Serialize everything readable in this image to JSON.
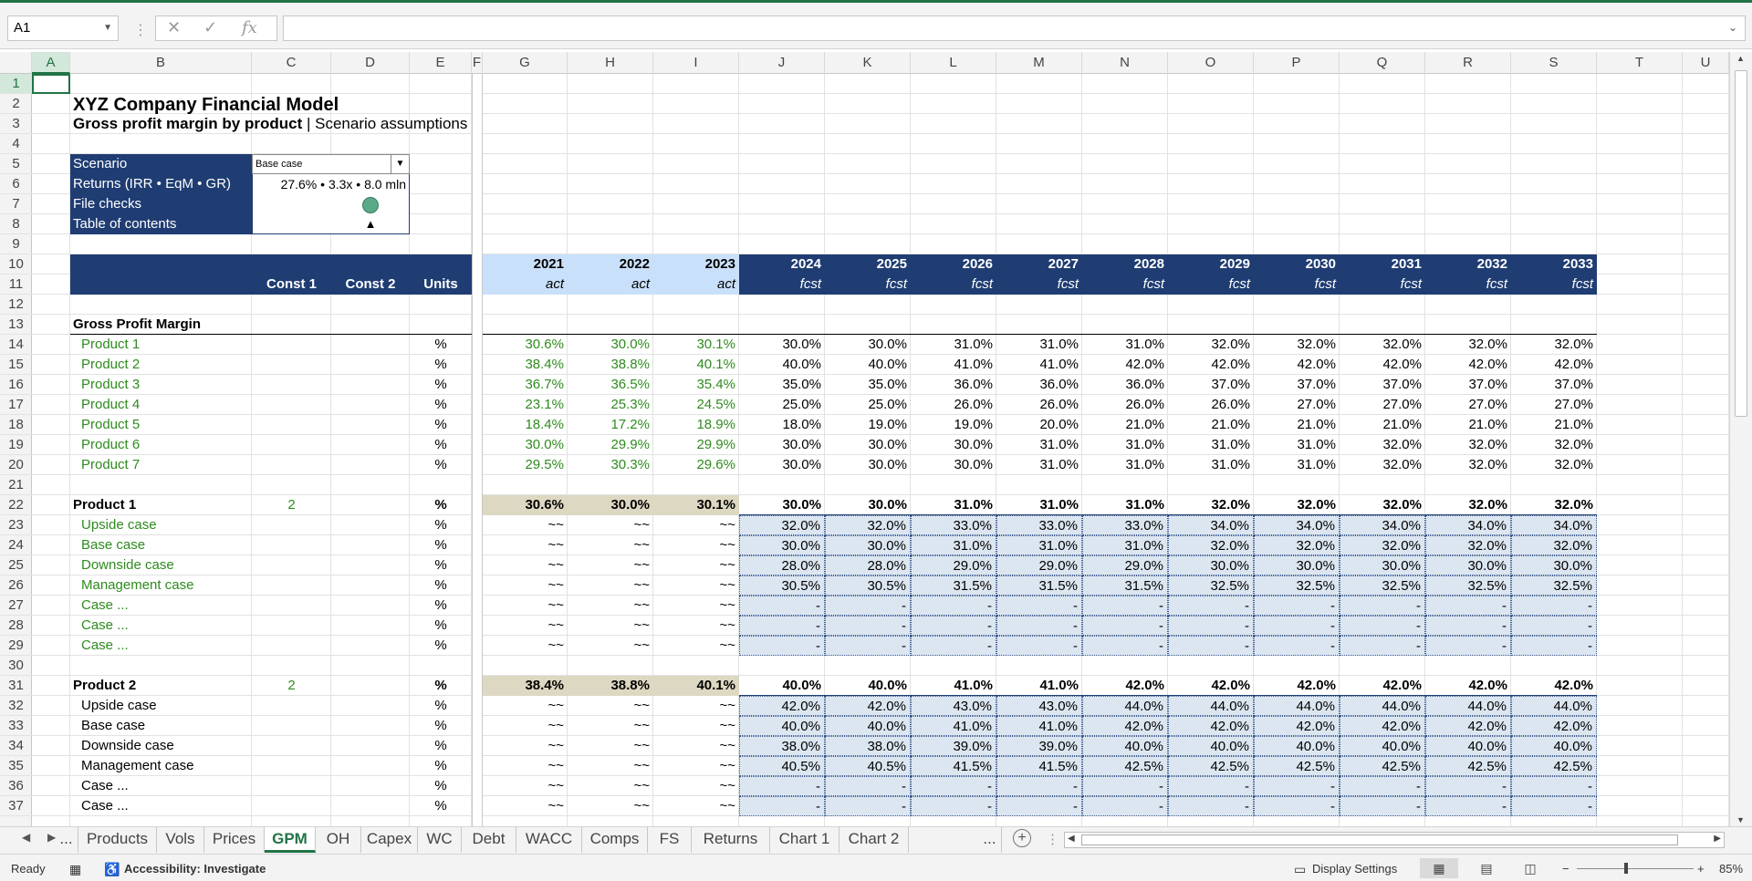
{
  "formula_bar": {
    "name_box": "A1",
    "formula": ""
  },
  "columns": [
    "A",
    "B",
    "C",
    "D",
    "E",
    "F",
    "G",
    "H",
    "I",
    "J",
    "K",
    "L",
    "M",
    "N",
    "O",
    "P",
    "Q",
    "R",
    "S",
    "T",
    "U"
  ],
  "rows": [
    "1",
    "2",
    "3",
    "4",
    "5",
    "6",
    "7",
    "8",
    "9",
    "10",
    "11",
    "12",
    "13",
    "14",
    "15",
    "16",
    "17",
    "18",
    "19",
    "20",
    "21",
    "22",
    "23",
    "24",
    "25",
    "26",
    "27",
    "28",
    "29",
    "30",
    "31",
    "32",
    "33",
    "34",
    "35",
    "36",
    "37"
  ],
  "title": "XYZ Company Financial Model",
  "subtitle_bold": "Gross profit margin by product",
  "subtitle_rest": " | Scenario assumptions",
  "info": {
    "scenario_label": "Scenario",
    "scenario_value": "Base case",
    "returns_label": "Returns (IRR • EqM • GR)",
    "returns_value": "27.6% • 3.3x • 8.0 mln",
    "checks_label": "File checks",
    "toc_label": "Table of contents",
    "toc_glyph": "▲",
    "check_color": "#5aaa8a"
  },
  "header": {
    "const1": "Const 1",
    "const2": "Const 2",
    "units": "Units",
    "years": [
      "2021",
      "2022",
      "2023",
      "2024",
      "2025",
      "2026",
      "2027",
      "2028",
      "2029",
      "2030",
      "2031",
      "2032",
      "2033"
    ],
    "kinds": [
      "act",
      "act",
      "act",
      "fcst",
      "fcst",
      "fcst",
      "fcst",
      "fcst",
      "fcst",
      "fcst",
      "fcst",
      "fcst",
      "fcst"
    ]
  },
  "gpm": {
    "label": "Gross Profit Margin",
    "rows": [
      {
        "name": "Product 1",
        "unit": "%",
        "v": [
          "30.6%",
          "30.0%",
          "30.1%",
          "30.0%",
          "30.0%",
          "31.0%",
          "31.0%",
          "31.0%",
          "32.0%",
          "32.0%",
          "32.0%",
          "32.0%",
          "32.0%"
        ]
      },
      {
        "name": "Product 2",
        "unit": "%",
        "v": [
          "38.4%",
          "38.8%",
          "40.1%",
          "40.0%",
          "40.0%",
          "41.0%",
          "41.0%",
          "42.0%",
          "42.0%",
          "42.0%",
          "42.0%",
          "42.0%",
          "42.0%"
        ]
      },
      {
        "name": "Product 3",
        "unit": "%",
        "v": [
          "36.7%",
          "36.5%",
          "35.4%",
          "35.0%",
          "35.0%",
          "36.0%",
          "36.0%",
          "36.0%",
          "37.0%",
          "37.0%",
          "37.0%",
          "37.0%",
          "37.0%"
        ]
      },
      {
        "name": "Product 4",
        "unit": "%",
        "v": [
          "23.1%",
          "25.3%",
          "24.5%",
          "25.0%",
          "25.0%",
          "26.0%",
          "26.0%",
          "26.0%",
          "26.0%",
          "27.0%",
          "27.0%",
          "27.0%",
          "27.0%"
        ]
      },
      {
        "name": "Product 5",
        "unit": "%",
        "v": [
          "18.4%",
          "17.2%",
          "18.9%",
          "18.0%",
          "19.0%",
          "19.0%",
          "20.0%",
          "21.0%",
          "21.0%",
          "21.0%",
          "21.0%",
          "21.0%",
          "21.0%"
        ]
      },
      {
        "name": "Product 6",
        "unit": "%",
        "v": [
          "30.0%",
          "29.9%",
          "29.9%",
          "30.0%",
          "30.0%",
          "30.0%",
          "31.0%",
          "31.0%",
          "31.0%",
          "31.0%",
          "32.0%",
          "32.0%",
          "32.0%"
        ]
      },
      {
        "name": "Product 7",
        "unit": "%",
        "v": [
          "29.5%",
          "30.3%",
          "29.6%",
          "30.0%",
          "30.0%",
          "30.0%",
          "31.0%",
          "31.0%",
          "31.0%",
          "31.0%",
          "32.0%",
          "32.0%",
          "32.0%"
        ]
      }
    ]
  },
  "blocks": [
    {
      "name": "Product 1",
      "const1": "2",
      "unit": "%",
      "green": true,
      "v": [
        "30.6%",
        "30.0%",
        "30.1%",
        "30.0%",
        "30.0%",
        "31.0%",
        "31.0%",
        "31.0%",
        "32.0%",
        "32.0%",
        "32.0%",
        "32.0%",
        "32.0%"
      ],
      "cases": [
        {
          "name": "Upside case",
          "unit": "%",
          "v": [
            "32.0%",
            "32.0%",
            "33.0%",
            "33.0%",
            "33.0%",
            "34.0%",
            "34.0%",
            "34.0%",
            "34.0%",
            "34.0%"
          ]
        },
        {
          "name": "Base case",
          "unit": "%",
          "v": [
            "30.0%",
            "30.0%",
            "31.0%",
            "31.0%",
            "31.0%",
            "32.0%",
            "32.0%",
            "32.0%",
            "32.0%",
            "32.0%"
          ]
        },
        {
          "name": "Downside case",
          "unit": "%",
          "v": [
            "28.0%",
            "28.0%",
            "29.0%",
            "29.0%",
            "29.0%",
            "30.0%",
            "30.0%",
            "30.0%",
            "30.0%",
            "30.0%"
          ]
        },
        {
          "name": "Management case",
          "unit": "%",
          "v": [
            "30.5%",
            "30.5%",
            "31.5%",
            "31.5%",
            "31.5%",
            "32.5%",
            "32.5%",
            "32.5%",
            "32.5%",
            "32.5%"
          ]
        },
        {
          "name": "Case ...",
          "unit": "%",
          "v": [
            "-",
            "-",
            "-",
            "-",
            "-",
            "-",
            "-",
            "-",
            "-",
            "-"
          ]
        },
        {
          "name": "Case ...",
          "unit": "%",
          "v": [
            "-",
            "-",
            "-",
            "-",
            "-",
            "-",
            "-",
            "-",
            "-",
            "-"
          ]
        },
        {
          "name": "Case ...",
          "unit": "%",
          "v": [
            "-",
            "-",
            "-",
            "-",
            "-",
            "-",
            "-",
            "-",
            "-",
            "-"
          ]
        }
      ]
    },
    {
      "name": "Product 2",
      "const1": "2",
      "unit": "%",
      "green": false,
      "v": [
        "38.4%",
        "38.8%",
        "40.1%",
        "40.0%",
        "40.0%",
        "41.0%",
        "41.0%",
        "42.0%",
        "42.0%",
        "42.0%",
        "42.0%",
        "42.0%",
        "42.0%"
      ],
      "cases": [
        {
          "name": "Upside case",
          "unit": "%",
          "v": [
            "42.0%",
            "42.0%",
            "43.0%",
            "43.0%",
            "44.0%",
            "44.0%",
            "44.0%",
            "44.0%",
            "44.0%",
            "44.0%"
          ]
        },
        {
          "name": "Base case",
          "unit": "%",
          "v": [
            "40.0%",
            "40.0%",
            "41.0%",
            "41.0%",
            "42.0%",
            "42.0%",
            "42.0%",
            "42.0%",
            "42.0%",
            "42.0%"
          ]
        },
        {
          "name": "Downside case",
          "unit": "%",
          "v": [
            "38.0%",
            "38.0%",
            "39.0%",
            "39.0%",
            "40.0%",
            "40.0%",
            "40.0%",
            "40.0%",
            "40.0%",
            "40.0%"
          ]
        },
        {
          "name": "Management case",
          "unit": "%",
          "v": [
            "40.5%",
            "40.5%",
            "41.5%",
            "41.5%",
            "42.5%",
            "42.5%",
            "42.5%",
            "42.5%",
            "42.5%",
            "42.5%"
          ]
        },
        {
          "name": "Case ...",
          "unit": "%",
          "v": [
            "-",
            "-",
            "-",
            "-",
            "-",
            "-",
            "-",
            "-",
            "-",
            "-"
          ]
        },
        {
          "name": "Case ...",
          "unit": "%",
          "v": [
            "-",
            "-",
            "-",
            "-",
            "-",
            "-",
            "-",
            "-",
            "-",
            "-"
          ]
        }
      ]
    }
  ],
  "tilde": "~~",
  "tabs": [
    "...",
    "Products",
    "Vols",
    "Prices",
    "GPM",
    "OH",
    "Capex",
    "WC",
    "Debt",
    "WACC",
    "Comps",
    "FS",
    "Returns",
    "Chart 1",
    "Chart 2",
    "..."
  ],
  "active_tab": "GPM",
  "status": {
    "ready": "Ready",
    "accessibility": "Accessibility: Investigate",
    "display_settings": "Display Settings",
    "zoom": "85%"
  },
  "colors": {
    "navy": "#1f3d73",
    "excel_green": "#217346",
    "input_blue": "#dce6f1",
    "actual_tan": "#ddd8c2",
    "header_light": "#c9e0fa",
    "text_green": "#2e8b1e"
  }
}
